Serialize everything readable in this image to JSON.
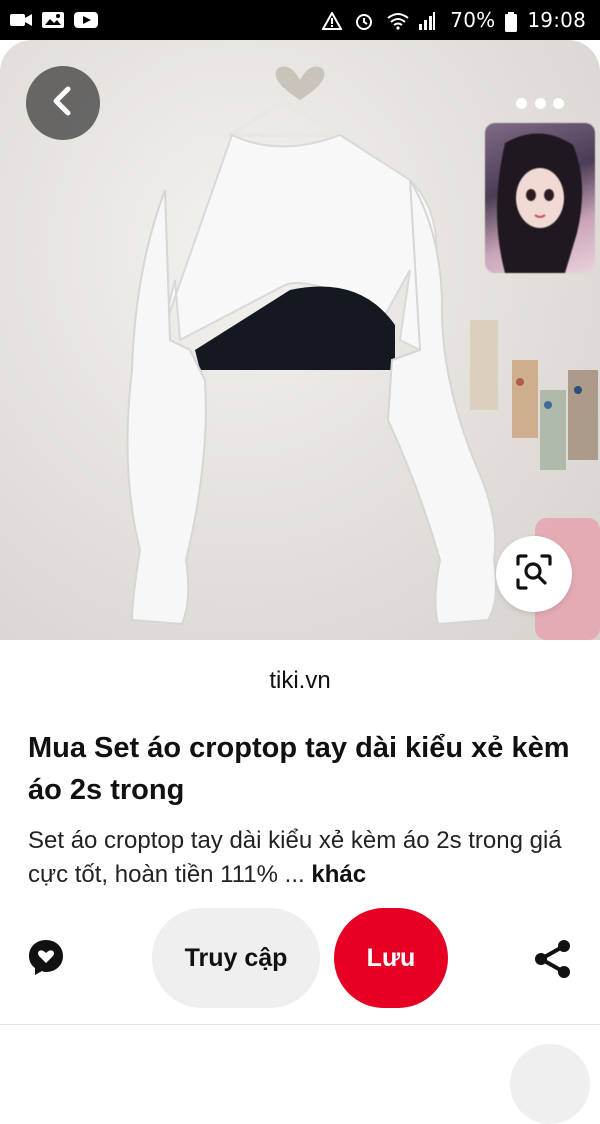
{
  "status_bar": {
    "battery": "70%",
    "time": "19:08",
    "left_icons": [
      "video-call-icon",
      "gallery-icon",
      "youtube-icon"
    ],
    "right_icons": [
      "alarm-warning-icon",
      "alarm-icon",
      "wifi-icon",
      "signal-icon",
      "battery-icon"
    ]
  },
  "pin": {
    "source": "tiki.vn",
    "title": "Mua Set áo croptop tay dài kiểu xẻ kèm áo 2s trong",
    "description": "Set áo croptop tay dài kiểu xẻ kèm áo 2s trong giá cực tốt, hoàn tiền 111% ...",
    "more_label": "khác"
  },
  "actions": {
    "visit_label": "Truy cập",
    "save_label": "Lưu"
  },
  "colors": {
    "accent": "#e60023",
    "secondary_button": "#efefef"
  },
  "icons": {
    "back": "chevron-left-icon",
    "more": "more-dots-icon",
    "lens": "visual-search-icon",
    "comment": "comment-icon",
    "share": "share-icon"
  }
}
